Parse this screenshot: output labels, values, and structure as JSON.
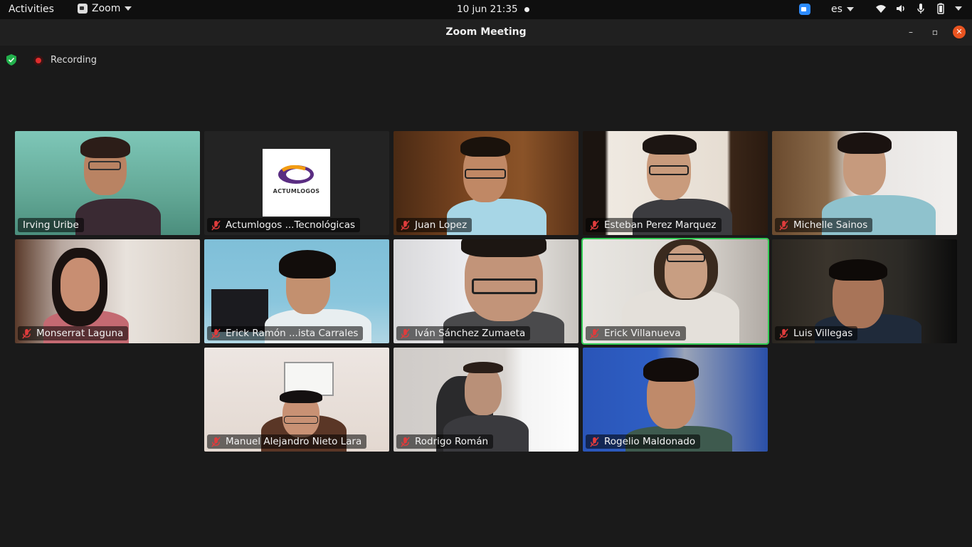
{
  "topbar": {
    "activities": "Activities",
    "app_name": "Zoom",
    "clock": "10 jun  21:35",
    "language": "es"
  },
  "window": {
    "title": "Zoom Meeting",
    "minimize": "–",
    "maximize": "▫",
    "close": "✕"
  },
  "status": {
    "recording_label": "Recording"
  },
  "colors": {
    "active_speaker_border": "#33cc55",
    "recording_red": "#e02d2d",
    "mute_red": "#e03c3c",
    "close_button": "#e95420"
  },
  "participants": [
    {
      "name": "Irving Uribe",
      "muted": false,
      "active": false
    },
    {
      "name": "Actumlogos ...Tecnológicas",
      "muted": true,
      "active": false,
      "logo_text": "ACTUMLOGOS"
    },
    {
      "name": "Juan Lopez",
      "muted": true,
      "active": false
    },
    {
      "name": "Esteban Perez Marquez",
      "muted": true,
      "active": false
    },
    {
      "name": "Michelle Sainos",
      "muted": true,
      "active": false
    },
    {
      "name": "Monserrat Laguna",
      "muted": true,
      "active": false
    },
    {
      "name": "Erick Ramón ...ista Carrales",
      "muted": true,
      "active": false
    },
    {
      "name": "Iván Sánchez Zumaeta",
      "muted": true,
      "active": false
    },
    {
      "name": "Erick Villanueva",
      "muted": true,
      "active": true
    },
    {
      "name": "Luis Villegas",
      "muted": true,
      "active": false
    },
    {
      "name": "Manuel Alejandro Nieto Lara",
      "muted": true,
      "active": false
    },
    {
      "name": "Rodrigo Román",
      "muted": true,
      "active": false
    },
    {
      "name": "Rogelio Maldonado",
      "muted": true,
      "active": false
    }
  ]
}
